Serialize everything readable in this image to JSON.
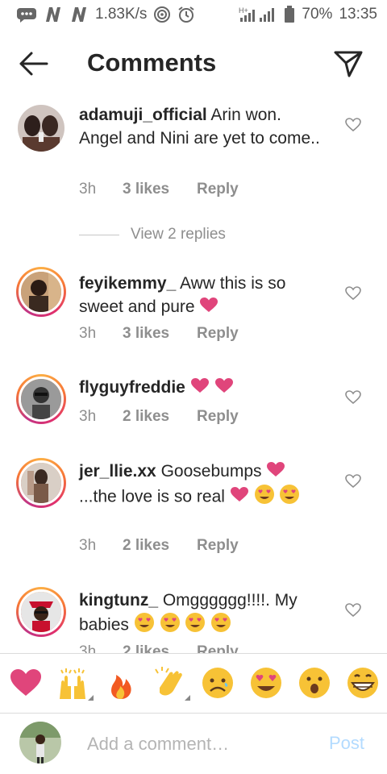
{
  "status_bar": {
    "speed": "1.83K/s",
    "battery": "70%",
    "time": "13:35",
    "network_label": "H+"
  },
  "header": {
    "title": "Comments"
  },
  "comments": [
    {
      "username": "adamuji_official",
      "text": "Arin won. Angel and Nini are yet to come..",
      "time": "3h",
      "likes": "3 likes",
      "reply": "Reply",
      "view_replies": "View 2 replies"
    },
    {
      "username": "feyikemmy_",
      "text": "Aww this is so sweet and pure",
      "time": "3h",
      "likes": "3 likes",
      "reply": "Reply"
    },
    {
      "username": "flyguyfreddie",
      "text": "",
      "time": "3h",
      "likes": "2 likes",
      "reply": "Reply"
    },
    {
      "username": "jer_llie.xx",
      "text": "Goosebumps",
      "text2": "...the love is so real",
      "time": "3h",
      "likes": "2 likes",
      "reply": "Reply"
    },
    {
      "username": "kingtunz_",
      "text": "Omgggggg!!!!. My babies",
      "time": "3h",
      "likes": "2 likes",
      "reply": "Reply"
    }
  ],
  "emoji_bar": [
    "heart",
    "raised-hands",
    "fire",
    "clapping-hands",
    "sad-face",
    "heart-eyes-face",
    "surprised-face",
    "grinning-face"
  ],
  "add_comment": {
    "placeholder": "Add a comment…",
    "post_label": "Post"
  },
  "colors": {
    "heart_pink": "#e0457b",
    "post_disabled": "#b3dbff",
    "meta_gray": "#8e8e8e",
    "emoji_yellow": "#f7c236"
  }
}
